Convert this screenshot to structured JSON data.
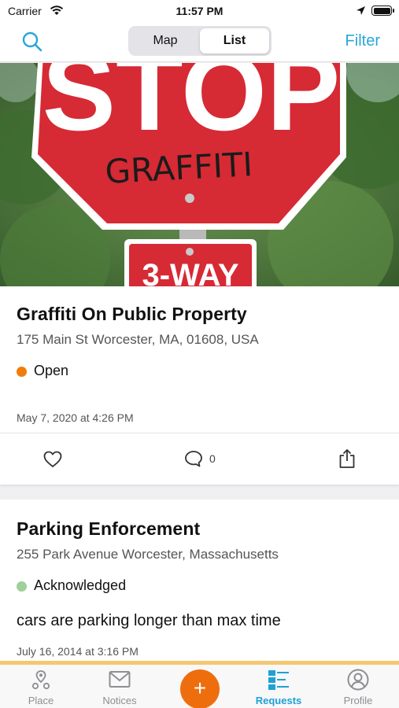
{
  "status_bar": {
    "carrier": "Carrier",
    "time": "11:57 PM"
  },
  "nav": {
    "search_icon": "search-icon",
    "segments": [
      "Map",
      "List"
    ],
    "selected_segment": "List",
    "filter_label": "Filter"
  },
  "feed": {
    "items": [
      {
        "image_text": [
          "STOP",
          "GRAFFITI",
          "3-WAY"
        ],
        "title": "Graffiti On Public Property",
        "address": "175 Main St Worcester, MA, 01608, USA",
        "status": "Open",
        "status_color": "#f07d0a",
        "date": "May 7, 2020 at 4:26 PM",
        "comment_count": "0"
      },
      {
        "title": "Parking Enforcement",
        "address": "255 Park Avenue Worcester, Massachusetts",
        "status": "Acknowledged",
        "status_color": "#9ed09a",
        "description": "cars are parking longer than max time",
        "date": "July 16, 2014 at 3:16 PM"
      }
    ]
  },
  "tab_bar": {
    "tabs": [
      {
        "label": "Place",
        "icon": "place-icon"
      },
      {
        "label": "Notices",
        "icon": "envelope-icon"
      },
      {
        "label": "+",
        "icon": "add-icon"
      },
      {
        "label": "Requests",
        "icon": "requests-list-icon"
      },
      {
        "label": "Profile",
        "icon": "profile-icon"
      }
    ],
    "active": "Requests",
    "active_color": "#1ea1d6",
    "accent_color": "#ee6e0e"
  }
}
